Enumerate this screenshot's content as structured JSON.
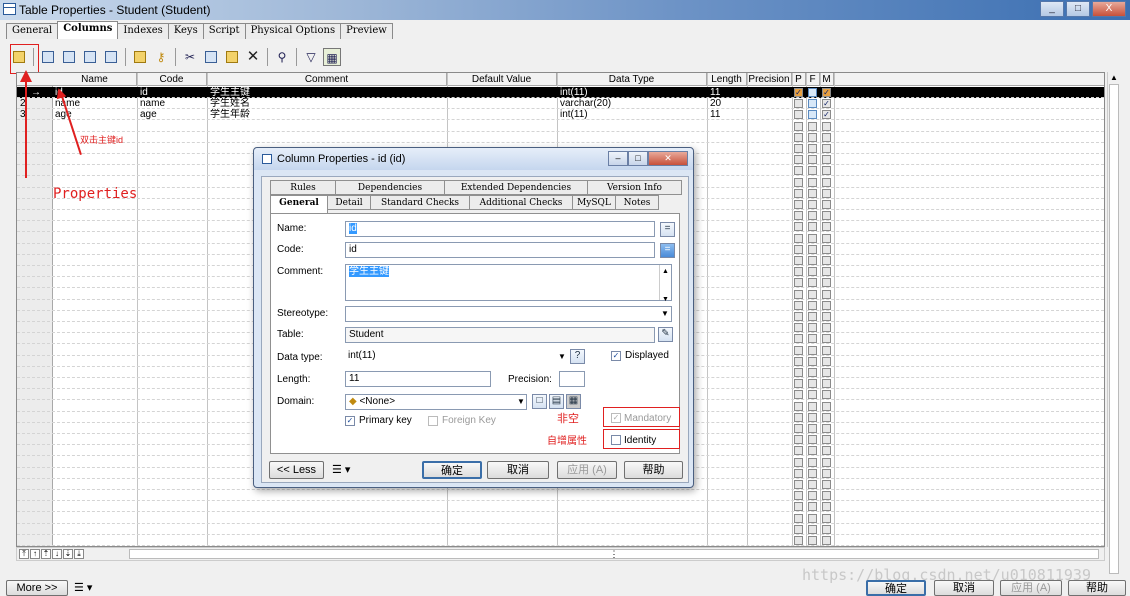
{
  "window": {
    "title": "Table Properties - Student (Student)",
    "buttons": {
      "minimize": "_",
      "maximize": "□",
      "close": "X"
    }
  },
  "tabs": [
    "General",
    "Columns",
    "Indexes",
    "Keys",
    "Script",
    "Physical Options",
    "Preview"
  ],
  "active_tab": "Columns",
  "grid": {
    "headers": [
      "Name",
      "Code",
      "Comment",
      "Default Value",
      "Data Type",
      "Length",
      "Precision",
      "P",
      "F",
      "M"
    ],
    "rows": [
      {
        "marker": "→",
        "name": "id",
        "code": "id",
        "comment": "学生主键",
        "default": "",
        "datatype": "int(11)",
        "length": "11",
        "precision": "",
        "p": "✓",
        "f": "",
        "m": "✓"
      },
      {
        "marker": "2",
        "name": "name",
        "code": "name",
        "comment": "学生姓名",
        "default": "",
        "datatype": "varchar(20)",
        "length": "20",
        "precision": "",
        "p": "",
        "f": "",
        "m": "✓"
      },
      {
        "marker": "3",
        "name": "age",
        "code": "age",
        "comment": "学生年龄",
        "default": "",
        "datatype": "int(11)",
        "length": "11",
        "precision": "",
        "p": "",
        "f": "",
        "m": "✓"
      }
    ]
  },
  "annotations": {
    "double_click": "双击主键id",
    "properties": "Properties",
    "not_null": "非空",
    "auto_increment": "自增属性"
  },
  "dialog": {
    "title": "Column Properties - id (id)",
    "tabs_row1": [
      "Rules",
      "Dependencies",
      "Extended Dependencies",
      "Version Info"
    ],
    "tabs_row2": [
      "General",
      "Detail",
      "Standard Checks",
      "Additional Checks",
      "MySQL",
      "Notes"
    ],
    "active_tab": "General",
    "fields": {
      "name_label": "Name:",
      "name_value": "id",
      "code_label": "Code:",
      "code_value": "id",
      "comment_label": "Comment:",
      "comment_value": "学生主键",
      "stereotype_label": "Stereotype:",
      "stereotype_value": "",
      "table_label": "Table:",
      "table_value": "Student",
      "datatype_label": "Data type:",
      "datatype_value": "int(11)",
      "displayed_label": "Displayed",
      "length_label": "Length:",
      "length_value": "11",
      "precision_label": "Precision:",
      "precision_value": "",
      "domain_label": "Domain:",
      "domain_value": "<None>",
      "primary_key_label": "Primary key",
      "foreign_key_label": "Foreign Key",
      "mandatory_label": "Mandatory",
      "identity_label": "Identity"
    },
    "buttons": {
      "less": "<< Less",
      "ok": "确定",
      "cancel": "取消",
      "apply": "应用 (A)",
      "help": "帮助"
    }
  },
  "bottom": {
    "more": "More >>",
    "ok": "确定",
    "cancel": "取消",
    "apply": "应用 (A)",
    "help": "帮助",
    "watermark": "https://blog.csdn.net/u010811939"
  }
}
